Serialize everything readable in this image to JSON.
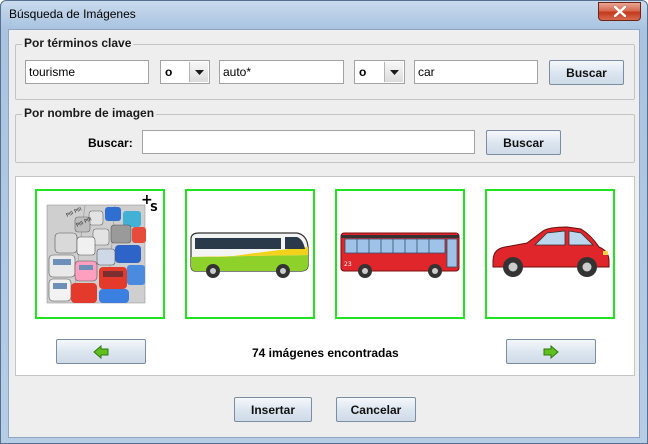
{
  "window": {
    "title": "Búsqueda de Imágenes"
  },
  "keywords": {
    "group_title": "Por términos clave",
    "term1": "tourisme",
    "op1": "o",
    "term2": "auto*",
    "op2": "o",
    "term3": "car",
    "search_label": "Buscar"
  },
  "by_name": {
    "group_title": "Por nombre de imagen",
    "field_label": "Buscar:",
    "field_value": "",
    "search_label": "Buscar"
  },
  "results": {
    "thumbnails": [
      {
        "name": "traffic-jam",
        "caption_top": "+",
        "caption_side": "S"
      },
      {
        "name": "green-coach-bus"
      },
      {
        "name": "red-city-bus",
        "number": "23"
      },
      {
        "name": "red-car"
      }
    ],
    "count_text": "74 imágenes encontradas",
    "prev_icon": "arrow-left-icon",
    "next_icon": "arrow-right-icon",
    "border_color": "#22e222"
  },
  "footer": {
    "insert_label": "Insertar",
    "cancel_label": "Cancelar"
  }
}
